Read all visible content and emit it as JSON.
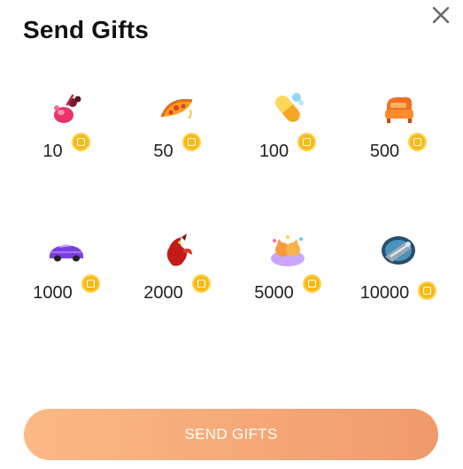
{
  "dialog": {
    "title": "Send Gifts"
  },
  "gifts": [
    {
      "icon": "cocktail-gift-icon",
      "price": "10"
    },
    {
      "icon": "pizza-gift-icon",
      "price": "50"
    },
    {
      "icon": "pill-gift-icon",
      "price": "100"
    },
    {
      "icon": "armchair-gift-icon",
      "price": "500"
    },
    {
      "icon": "sports-car-gift-icon",
      "price": "1000"
    },
    {
      "icon": "dragon-gift-icon",
      "price": "2000"
    },
    {
      "icon": "party-cat-gift-icon",
      "price": "5000"
    },
    {
      "icon": "spaceship-gift-icon",
      "price": "10000"
    }
  ],
  "send_button": {
    "label": "SEND GIFTS"
  },
  "colors": {
    "coin": "#f6b917",
    "button_start": "#fcb985",
    "button_end": "#f09a6c"
  }
}
